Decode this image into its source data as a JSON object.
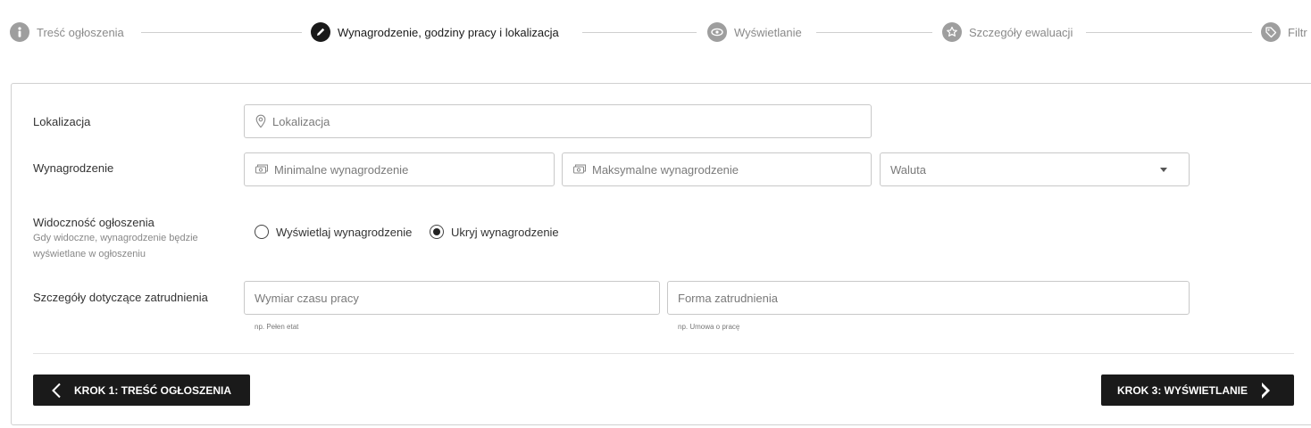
{
  "stepper": {
    "steps": [
      {
        "label": "Treść ogłoszenia",
        "icon": "info-icon",
        "state": "inactive"
      },
      {
        "label": "Wynagrodzenie, godziny pracy i lokalizacja",
        "icon": "pencil-icon",
        "state": "active"
      },
      {
        "label": "Wyświetlanie",
        "icon": "eye-icon",
        "state": "inactive"
      },
      {
        "label": "Szczegóły ewaluacji",
        "icon": "star-icon",
        "state": "inactive"
      },
      {
        "label": "Filtr",
        "icon": "tag-icon",
        "state": "inactive"
      }
    ]
  },
  "form": {
    "location": {
      "label": "Lokalizacja",
      "placeholder": "Lokalizacja",
      "value": ""
    },
    "salary": {
      "label": "Wynagrodzenie",
      "min_placeholder": "Minimalne wynagrodzenie",
      "max_placeholder": "Maksymalne wynagrodzenie",
      "currency_placeholder": "Waluta"
    },
    "visibility": {
      "label": "Widoczność ogłoszenia",
      "sublabel_line1": "Gdy widoczne, wynagrodzenie będzie",
      "sublabel_line2": "wyświetlane w ogłoszeniu",
      "options": [
        {
          "label": "Wyświetlaj wynagrodzenie",
          "selected": false
        },
        {
          "label": "Ukryj wynagrodzenie",
          "selected": true
        }
      ]
    },
    "employment": {
      "label": "Szczegóły dotyczące zatrudnienia",
      "work_time_placeholder": "Wymiar czasu pracy",
      "work_time_hint": "np. Pełen etat",
      "contract_placeholder": "Forma zatrudnienia",
      "contract_hint": "np. Umowa o pracę"
    }
  },
  "nav": {
    "prev_label": "KROK 1: TREŚĆ OGŁOSZENIA",
    "next_label": "KROK 3: WYŚWIETLANIE"
  },
  "colors": {
    "accent_dark": "#1a1a1a",
    "inactive_step": "#9e9e9e",
    "border": "#c8c8c8"
  }
}
